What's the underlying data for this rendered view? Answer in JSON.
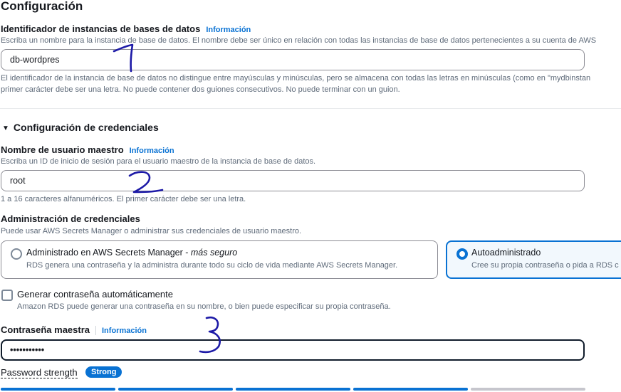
{
  "page_title": "Configuración",
  "instance_id": {
    "label": "Identificador de instancias de bases de datos",
    "info": "Información",
    "description": "Escriba un nombre para la instancia de base de datos. El nombre debe ser único en relación con todas las instancias de base de datos pertenecientes a su cuenta de AWS",
    "value": "db-wordpres",
    "constraint_1": "El identificador de la instancia de base de datos no distingue entre mayúsculas y minúsculas, pero se almacena con todas las letras en minúsculas (como en \"mydbinstan",
    "constraint_2": "primer carácter debe ser una letra. No puede contener dos guiones consecutivos. No puede terminar con un guion."
  },
  "credentials": {
    "section_title": "Configuración de credenciales",
    "master_user": {
      "label": "Nombre de usuario maestro",
      "info": "Información",
      "description": "Escriba un ID de inicio de sesión para el usuario maestro de la instancia de base de datos.",
      "value": "root",
      "constraint": "1 a 16 caracteres alfanuméricos. El primer carácter debe ser una letra."
    },
    "management": {
      "label": "Administración de credenciales",
      "description": "Puede usar AWS Secrets Manager o administrar sus credenciales de usuario maestro.",
      "options": [
        {
          "title": "Administrado en AWS Secrets Manager - ",
          "title_emphasis": "más seguro",
          "description": "RDS genera una contraseña y la administra durante todo su ciclo de vida mediante AWS Secrets Manager.",
          "selected": false
        },
        {
          "title": "Autoadministrado",
          "description": "Cree su propia contraseña o pida a RDS c",
          "selected": true
        }
      ]
    },
    "auto_password": {
      "label": "Generar contraseña automáticamente",
      "description": "Amazon RDS puede generar una contraseña en su nombre, o bien puede especificar su propia contraseña.",
      "checked": false
    },
    "master_password": {
      "label": "Contraseña maestra",
      "info": "Información",
      "value": "•••••••••••"
    },
    "strength": {
      "label": "Password strength",
      "badge": "Strong",
      "filled_segments": 4,
      "total_segments": 5
    }
  },
  "annotations": [
    "1",
    "2",
    "3"
  ],
  "colors": {
    "accent": "#0972d3",
    "annotation_ink": "#1d1aa7",
    "text": "#16191f",
    "secondary_text": "#5f6b7a"
  }
}
